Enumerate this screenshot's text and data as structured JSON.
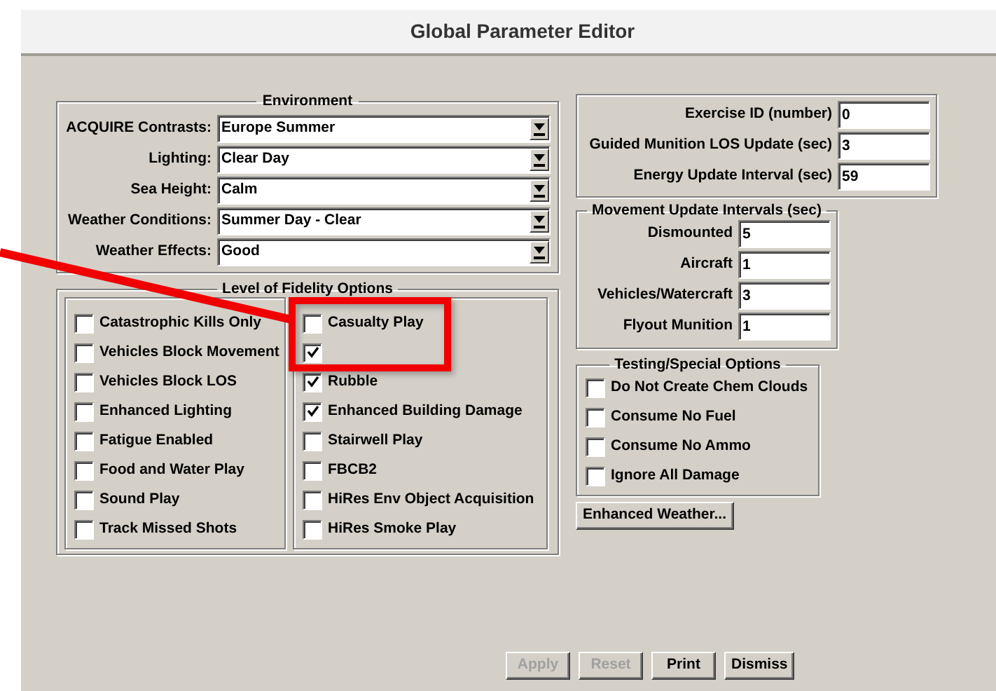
{
  "window": {
    "title": "Global Parameter Editor"
  },
  "environment": {
    "title": "Environment",
    "fields": [
      {
        "label": "ACQUIRE Contrasts:",
        "value": "Europe Summer"
      },
      {
        "label": "Lighting:",
        "value": "Clear Day"
      },
      {
        "label": "Sea Height:",
        "value": "Calm"
      },
      {
        "label": "Weather Conditions:",
        "value": "Summer Day - Clear"
      },
      {
        "label": "Weather Effects:",
        "value": "Good"
      }
    ]
  },
  "fidelity": {
    "title": "Level of Fidelity Options",
    "columns": [
      [
        {
          "label": "Catastrophic Kills Only",
          "checked": false
        },
        {
          "label": "Vehicles Block Movement",
          "checked": false
        },
        {
          "label": "Vehicles Block LOS",
          "checked": false
        },
        {
          "label": "Enhanced Lighting",
          "checked": false
        },
        {
          "label": "Fatigue Enabled",
          "checked": false
        },
        {
          "label": "Food and Water Play",
          "checked": false
        },
        {
          "label": "Sound Play",
          "checked": false
        },
        {
          "label": "Track Missed Shots",
          "checked": false
        }
      ],
      [
        {
          "label": "Casualty Play",
          "checked": false
        },
        {
          "checked": true
        },
        {
          "label": "Rubble",
          "checked": true
        },
        {
          "label": "Enhanced Building Damage",
          "checked": true
        },
        {
          "label": "Stairwell Play",
          "checked": false
        },
        {
          "label": "FBCB2",
          "checked": false
        },
        {
          "label": "HiRes Env Object Acquisition",
          "checked": false
        },
        {
          "label": "HiRes Smoke Play",
          "checked": false
        }
      ]
    ]
  },
  "general": {
    "fields": [
      {
        "label": "Exercise ID (number)",
        "value": "0"
      },
      {
        "label": "Guided Munition LOS Update (sec)",
        "value": "3"
      },
      {
        "label": "Energy Update Interval (sec)",
        "value": "59"
      }
    ]
  },
  "movement": {
    "title": "Movement Update Intervals (sec)",
    "fields": [
      {
        "label": "Dismounted",
        "value": "5"
      },
      {
        "label": "Aircraft",
        "value": "1"
      },
      {
        "label": "Vehicles/Watercraft",
        "value": "3"
      },
      {
        "label": "Flyout Munition",
        "value": "1"
      }
    ]
  },
  "testing": {
    "title": "Testing/Special Options",
    "options": [
      {
        "label": "Do Not Create Chem Clouds",
        "checked": false
      },
      {
        "label": "Consume No Fuel",
        "checked": false
      },
      {
        "label": "Consume No Ammo",
        "checked": false
      },
      {
        "label": "Ignore All Damage",
        "checked": false
      }
    ]
  },
  "enhanced_weather_button": {
    "label": "Enhanced Weather..."
  },
  "buttons": [
    {
      "label": "Apply",
      "disabled": true
    },
    {
      "label": "Reset",
      "disabled": true
    },
    {
      "label": "Print",
      "disabled": false
    },
    {
      "label": "Dismiss",
      "disabled": false
    }
  ]
}
